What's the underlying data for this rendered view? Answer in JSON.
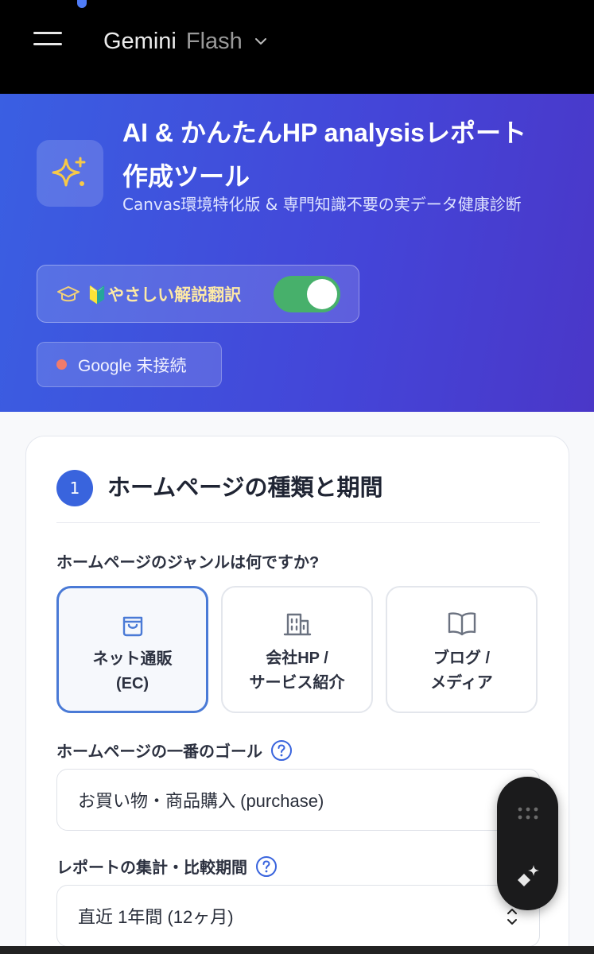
{
  "topbar": {
    "model_name": "Gemini",
    "model_variant": "Flash"
  },
  "hero": {
    "title_line1": "AI & かんたんHP analysisレポート",
    "title_line2": "作成ツール",
    "subtitle": "Canvas環境特化版 & 専門知識不要の実データ健康診断",
    "toggle_label": "🔰やさしい解説翻訳",
    "toggle_on": true,
    "connection_status": "Google 未接続",
    "icon": "sparkles-icon"
  },
  "section1": {
    "step_number": "1",
    "title": "ホームページの種類と期間",
    "genre_question": "ホームページのジャンルは何ですか?",
    "genres": [
      {
        "label": "ネット通販\n(EC)",
        "icon": "shopping-bag-icon",
        "selected": true
      },
      {
        "label": "会社HP /\nサービス紹介",
        "icon": "building-icon",
        "selected": false
      },
      {
        "label": "ブログ /\nメディア",
        "icon": "book-icon",
        "selected": false
      }
    ],
    "goal_label": "ホームページの一番のゴール",
    "goal_value": "お買い物・商品購入 (purchase)",
    "period_label": "レポートの集計・比較期間",
    "period_value": "直近 1年間 (12ヶ月)"
  },
  "colors": {
    "accent": "#3964dd",
    "toggle_on": "#47b06b",
    "disconnected": "#f07b6c"
  }
}
